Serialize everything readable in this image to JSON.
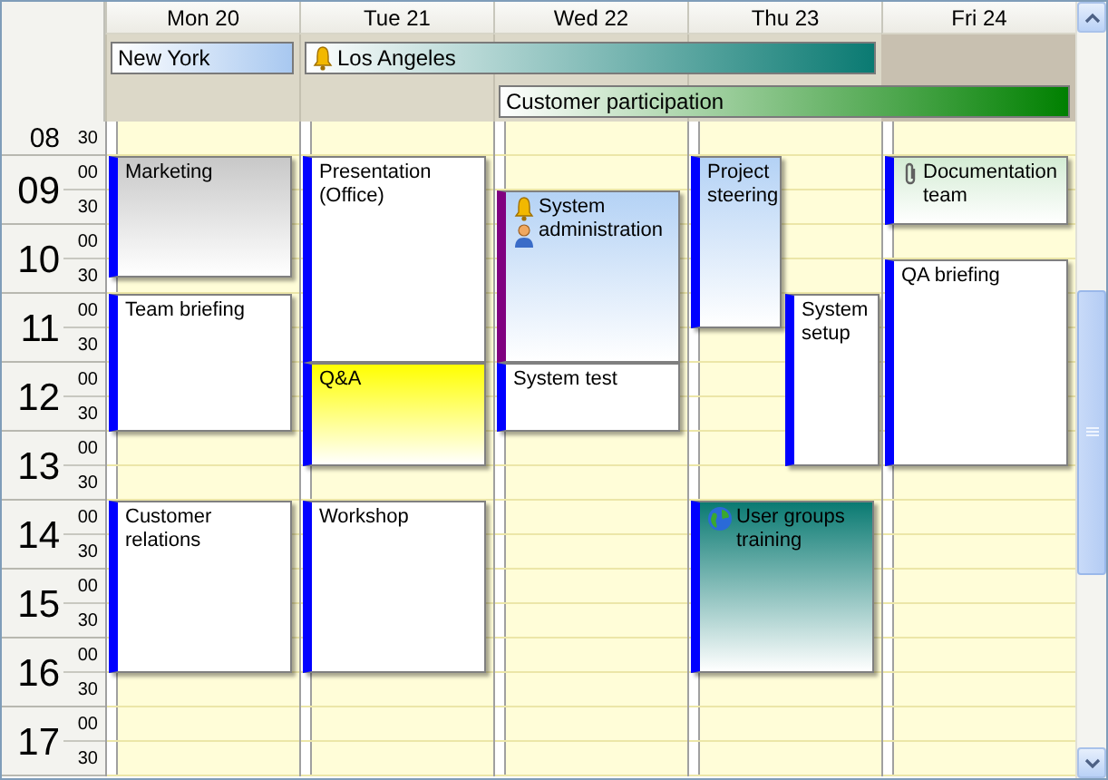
{
  "days": [
    {
      "label": "Mon 20",
      "events": [
        {
          "title": "Marketing",
          "color": "#c8c8c8"
        },
        {
          "title": "Team briefing",
          "color": "#ffffff"
        },
        {
          "title": "Customer relations",
          "color": "#ffffff"
        }
      ]
    },
    {
      "label": "Tue 21",
      "events": [
        {
          "title": "Presentation (Office)",
          "color": "#ffffff"
        },
        {
          "title": "Q&A",
          "color": "#ffff00"
        },
        {
          "title": "Workshop",
          "color": "#ffffff"
        }
      ]
    },
    {
      "label": "Wed 22",
      "events": [
        {
          "title": "System administration",
          "color": "#b4d2f5"
        },
        {
          "title": "System test",
          "color": "#ffffff"
        }
      ]
    },
    {
      "label": "Thu 23",
      "events": [
        {
          "title": "Project steering",
          "color": "#b4d2f5"
        },
        {
          "title": "System setup",
          "color": "#ffffff"
        },
        {
          "title": "User groups training",
          "color": "#0a7a72"
        }
      ]
    },
    {
      "label": "Fri 24",
      "events": [
        {
          "title": "Documentation team",
          "color": "#d4ecd4"
        },
        {
          "title": "QA briefing",
          "color": "#ffffff"
        }
      ]
    }
  ],
  "all_day": [
    {
      "title": "New York",
      "color": "#a8c8f0"
    },
    {
      "title": "Los Angeles",
      "color": "#0a7a72"
    },
    {
      "title": "Customer participation",
      "color": "#008000"
    }
  ],
  "hours": [
    {
      "hour": "08",
      "marks": [
        "30"
      ]
    },
    {
      "hour": "09",
      "marks": [
        "00",
        "30"
      ]
    },
    {
      "hour": "10",
      "marks": [
        "00",
        "30"
      ]
    },
    {
      "hour": "11",
      "marks": [
        "00",
        "30"
      ]
    },
    {
      "hour": "12",
      "marks": [
        "00",
        "30"
      ]
    },
    {
      "hour": "13",
      "marks": [
        "00",
        "30"
      ]
    },
    {
      "hour": "14",
      "marks": [
        "00",
        "30"
      ]
    },
    {
      "hour": "15",
      "marks": [
        "00",
        "30"
      ]
    },
    {
      "hour": "16",
      "marks": [
        "00",
        "30"
      ]
    },
    {
      "hour": "17",
      "marks": [
        "00",
        "30"
      ]
    }
  ]
}
